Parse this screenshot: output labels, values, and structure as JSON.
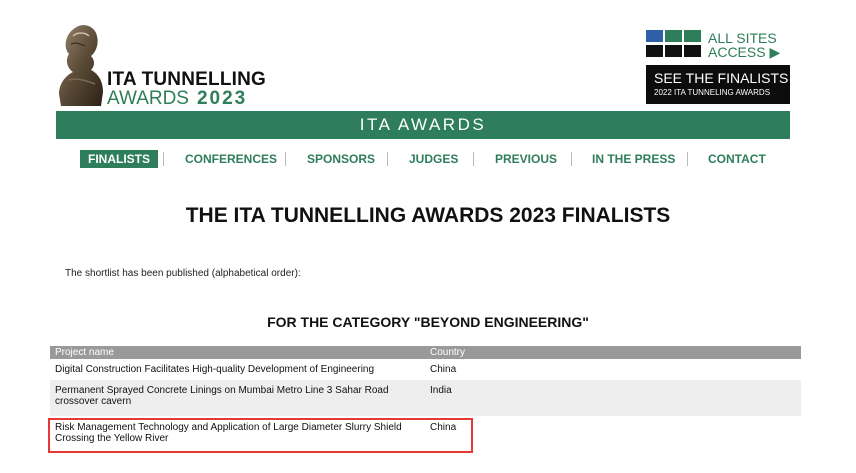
{
  "header": {
    "logo_line1": "ITA TUNNELLING",
    "logo_line2": "AWARDS",
    "logo_year": "2023",
    "all_sites_line1": "ALL SITES",
    "all_sites_line2": "ACCESS ▶",
    "finalists_big": "SEE THE FINALISTS ▸",
    "finalists_small": "2022 ITA TUNNELING AWARDS",
    "banner": "ITA AWARDS",
    "grid_colors": [
      "#2f5fa8",
      "#2e7d5b",
      "#2e7d5b",
      "#111111",
      "#111111",
      "#111111"
    ],
    "accent_color": "#2e7d5b"
  },
  "nav": {
    "items": [
      {
        "label": "FINALISTS",
        "active": true
      },
      {
        "label": "CONFERENCES"
      },
      {
        "label": "SPONSORS"
      },
      {
        "label": "JUDGES"
      },
      {
        "label": "PREVIOUS"
      },
      {
        "label": "IN THE PRESS"
      },
      {
        "label": "CONTACT"
      }
    ]
  },
  "main": {
    "title": "THE ITA TUNNELLING AWARDS 2023 FINALISTS",
    "intro": "The shortlist has been published (alphabetical order):",
    "category": "FOR THE CATEGORY \"BEYOND ENGINEERING\""
  },
  "table": {
    "headers": [
      "Project name",
      "Country"
    ],
    "rows": [
      {
        "project": "Digital Construction Facilitates High-quality Development of Engineering",
        "country": "China"
      },
      {
        "project": "Permanent Sprayed Concrete Linings on Mumbai Metro Line 3 Sahar Road crossover cavern",
        "country": "India"
      },
      {
        "project": "Risk Management Technology and Application of Large Diameter Slurry Shield Crossing the Yellow River",
        "country": "China"
      }
    ]
  }
}
